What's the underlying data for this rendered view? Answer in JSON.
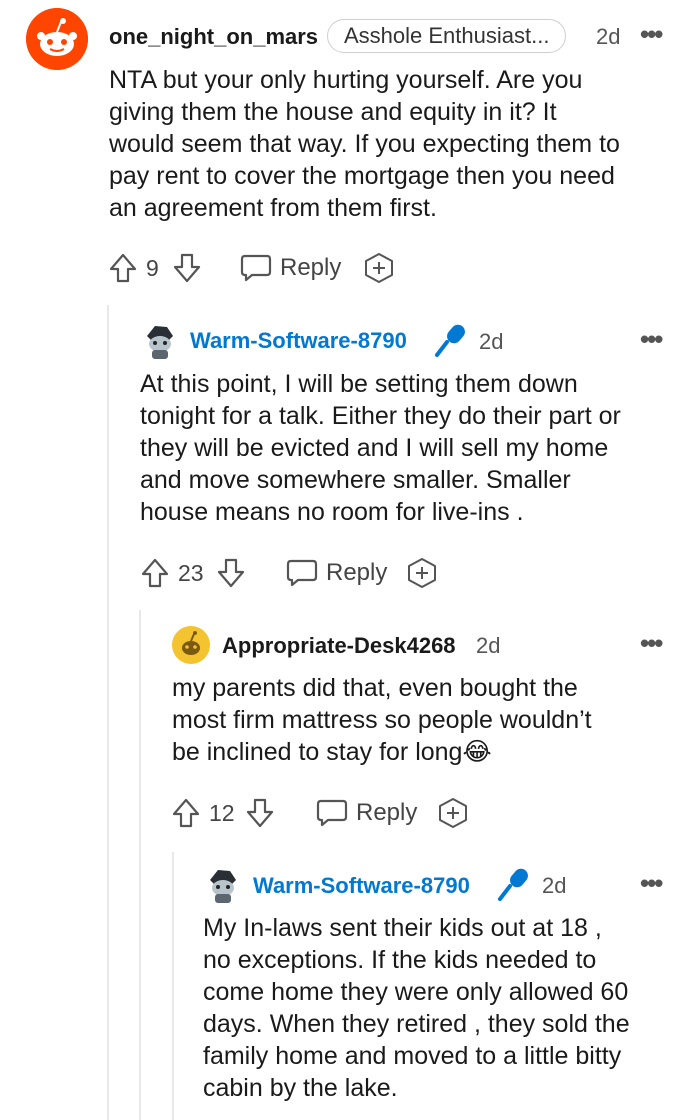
{
  "comments": [
    {
      "username": "one_night_on_mars",
      "flair": "Asshole Enthusiast...",
      "time": "2d",
      "body": "NTA but your only hurting yourself. Are you\ngiving them the house and equity in it? It\nwould seem that way. If you expecting them to\npay rent to cover the mortgage then you need\nan agreement from them first.",
      "votes": "9",
      "reply_label": "Reply"
    },
    {
      "username": "Warm-Software-8790",
      "time": "2d",
      "body": "At this point, I will be setting them down\ntonight for a talk. Either they do their part or\nthey will be evicted and I will sell my home\nand move somewhere smaller. Smaller\nhouse means no room for live-ins .",
      "votes": "23",
      "reply_label": "Reply"
    },
    {
      "username": "Appropriate-Desk4268",
      "time": "2d",
      "body": "my parents did that, even bought the\nmost firm mattress so people wouldn’t\nbe inclined to stay for long😂",
      "votes": "12",
      "reply_label": "Reply"
    },
    {
      "username": "Warm-Software-8790",
      "time": "2d",
      "body": "My In-laws sent their kids out at 18 ,\nno exceptions. If the kids needed to\ncome home they were only allowed 60\ndays. When they retired , they sold the\nfamily home and moved to a little bitty\ncabin by the lake."
    }
  ],
  "colors": {
    "op_username": "#0079d3",
    "action_gray": "#555555",
    "thread_line": "#e8e8e8"
  }
}
